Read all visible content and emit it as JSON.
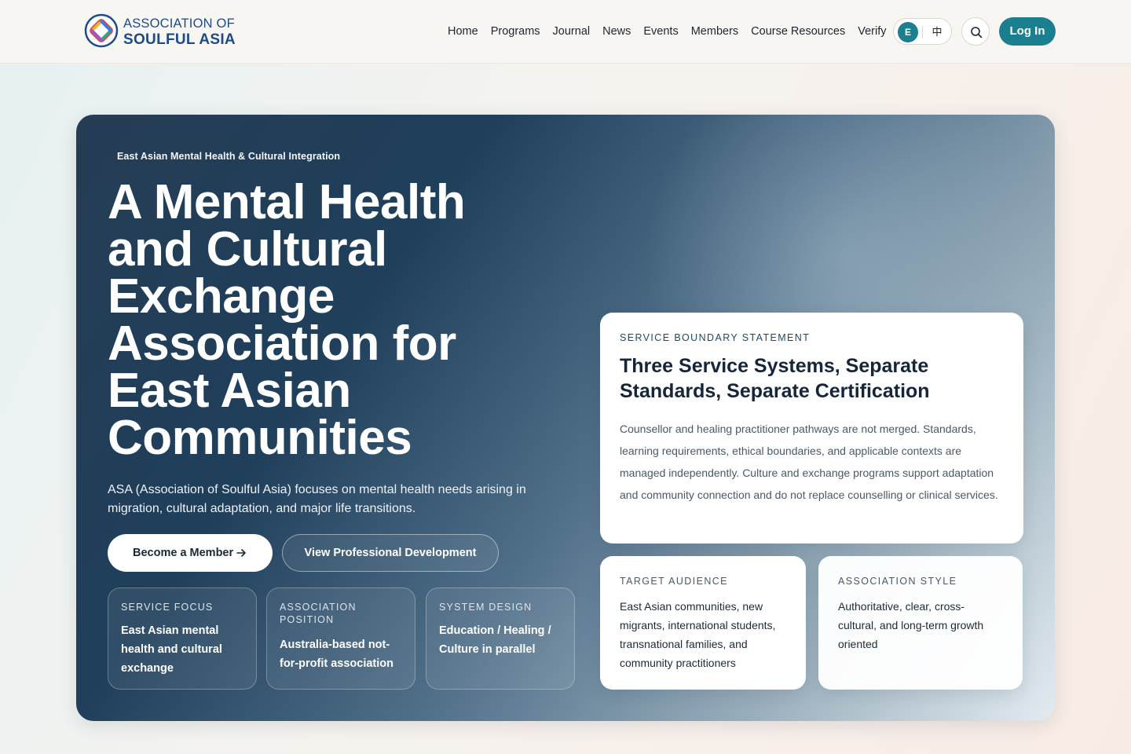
{
  "header": {
    "logo": {
      "line1": "ASSOCIATION OF",
      "line2": "SOULFUL ASIA"
    },
    "nav": [
      "Home",
      "Programs",
      "Journal",
      "News",
      "Events",
      "Members",
      "Course Resources",
      "Verify"
    ],
    "lang": {
      "en": "E",
      "zh": "中"
    },
    "login_label": "Log In"
  },
  "hero": {
    "eyebrow": "East Asian Mental Health & Cultural Integration",
    "title": "A Mental Health and Cultural Exchange Association for East Asian Communities",
    "description": "ASA (Association of Soulful Asia) focuses on mental health needs arising in migration, cultural adaptation, and major life transitions.",
    "primary_cta": "Become a Member",
    "secondary_cta": "View Professional Development",
    "stats": [
      {
        "label": "SERVICE FOCUS",
        "value": "East Asian mental health and cultural exchange"
      },
      {
        "label": "ASSOCIATION POSITION",
        "value": "Australia-based not-for-profit association"
      },
      {
        "label": "SYSTEM DESIGN",
        "value": "Education / Healing / Culture in parallel"
      }
    ]
  },
  "boundary_card": {
    "kicker": "SERVICE BOUNDARY STATEMENT",
    "title": "Three Service Systems, Separate Standards, Separate Certification",
    "body": "Counsellor and healing practitioner pathways are not merged. Standards, learning requirements, ethical boundaries, and applicable contexts are managed independently. Culture and exchange programs support adaptation and community connection and do not replace counselling or clinical services."
  },
  "audience_card": {
    "kicker": "TARGET AUDIENCE",
    "body": "East Asian communities, new migrants, international students, transnational families, and community practitioners"
  },
  "style_card": {
    "kicker": "ASSOCIATION STYLE",
    "body": "Authoritative, clear, cross-cultural, and long-term growth oriented"
  },
  "colors": {
    "accent": "#1a7f8e",
    "brand_text": "#1e4a8a",
    "hero_dark": "#1f3f5b"
  },
  "icons": [
    "logo-mark-icon",
    "search-icon",
    "arrow-right-icon"
  ]
}
